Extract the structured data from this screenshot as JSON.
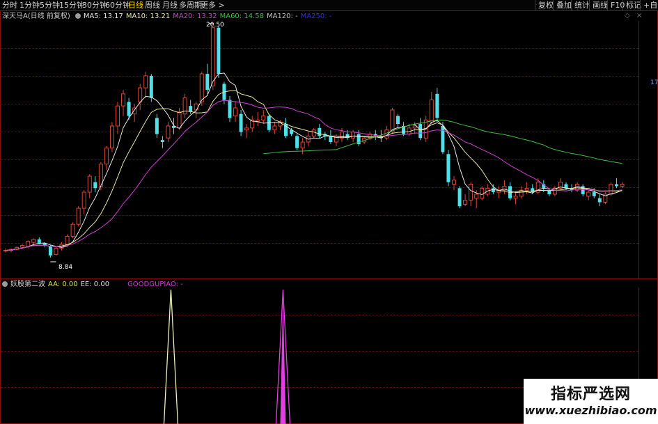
{
  "toolbar": {
    "periods": [
      "分时",
      "1分钟",
      "5分钟",
      "15分钟",
      "30分钟",
      "60分钟",
      "日线",
      "周线",
      "月线",
      "多周期",
      "更多 >"
    ],
    "active_period": "日线",
    "buttons": [
      "复权",
      "叠加",
      "统计",
      "画线",
      "F10",
      "标记",
      "+自选"
    ]
  },
  "main_chart": {
    "stock_name": "深天马A",
    "adjust_mode": "(日线 前复权)",
    "ma": [
      {
        "label": "MA5: 13.17",
        "color": "#e8e8e8"
      },
      {
        "label": "MA10: 13.21",
        "color": "#e8e8a0"
      },
      {
        "label": "MA20: 13.32",
        "color": "#d040d0"
      },
      {
        "label": "MA60: 14.58",
        "color": "#40c040"
      },
      {
        "label": "MA120: -",
        "color": "#c0c0c0"
      },
      {
        "label": "MA250: -",
        "color": "#3030e0"
      }
    ],
    "high_label": "20.50",
    "low_label": "8.84",
    "right_axis_label": "17"
  },
  "indicator": {
    "name": "妖股第二波",
    "values": [
      {
        "label": "AA: 0.00",
        "color": "#e0e060"
      },
      {
        "label": "EE: 0.00",
        "color": "#e0e0e0"
      },
      {
        "label": "GOODGUPIAO: -",
        "color": "#d040d0"
      }
    ],
    "spikes": [
      {
        "bar_index": 29,
        "value": 1.0,
        "color": "#f0f0c0"
      },
      {
        "bar_index": 49,
        "value": 1.0,
        "color": "#e040e0"
      }
    ]
  },
  "colors": {
    "up": "#d84a3a",
    "down": "#50e0e8",
    "frame": "#8a1010"
  },
  "candles": [
    [
      9.2,
      9.3,
      9.1,
      9.2
    ],
    [
      9.2,
      9.3,
      9.1,
      9.25
    ],
    [
      9.25,
      9.4,
      9.2,
      9.35
    ],
    [
      9.35,
      9.5,
      9.3,
      9.45
    ],
    [
      9.4,
      9.7,
      9.3,
      9.65
    ],
    [
      9.6,
      9.8,
      9.4,
      9.75
    ],
    [
      9.75,
      9.85,
      9.5,
      9.55
    ],
    [
      9.55,
      9.6,
      9.35,
      9.45
    ],
    [
      9.4,
      9.45,
      8.84,
      8.95
    ],
    [
      9.0,
      9.4,
      8.95,
      9.3
    ],
    [
      9.3,
      9.6,
      9.2,
      9.5
    ],
    [
      9.5,
      10.0,
      9.4,
      9.9
    ],
    [
      9.9,
      10.6,
      9.8,
      10.5
    ],
    [
      10.5,
      11.4,
      10.4,
      11.3
    ],
    [
      11.3,
      12.2,
      11.0,
      12.1
    ],
    [
      12.1,
      13.0,
      11.8,
      12.9
    ],
    [
      12.6,
      12.9,
      12.1,
      12.3
    ],
    [
      12.4,
      13.6,
      12.2,
      13.5
    ],
    [
      13.5,
      14.4,
      13.2,
      14.3
    ],
    [
      14.3,
      15.6,
      14.1,
      15.4
    ],
    [
      15.4,
      16.6,
      15.0,
      16.4
    ],
    [
      16.4,
      17.2,
      15.9,
      17.0
    ],
    [
      16.6,
      16.8,
      15.7,
      15.9
    ],
    [
      16.0,
      16.5,
      15.6,
      16.3
    ],
    [
      16.6,
      17.5,
      16.2,
      17.3
    ],
    [
      17.3,
      18.1,
      16.8,
      17.9
    ],
    [
      17.9,
      18.0,
      16.6,
      16.8
    ],
    [
      15.8,
      16.0,
      14.8,
      15.0
    ],
    [
      14.7,
      14.9,
      14.3,
      14.6
    ],
    [
      14.8,
      15.6,
      14.6,
      15.4
    ],
    [
      15.4,
      15.8,
      15.0,
      15.3
    ],
    [
      15.3,
      16.3,
      15.2,
      16.1
    ],
    [
      16.0,
      17.0,
      15.8,
      16.8
    ],
    [
      16.4,
      16.7,
      16.0,
      16.1
    ],
    [
      16.2,
      16.6,
      15.8,
      16.5
    ],
    [
      16.6,
      18.1,
      16.4,
      18.0
    ],
    [
      18.0,
      18.5,
      17.0,
      17.2
    ],
    [
      17.4,
      20.5,
      17.2,
      20.3
    ],
    [
      20.3,
      20.4,
      17.8,
      18.0
    ],
    [
      17.5,
      17.6,
      16.5,
      16.7
    ],
    [
      16.7,
      16.9,
      15.6,
      15.8
    ],
    [
      15.9,
      16.6,
      15.6,
      16.3
    ],
    [
      16.0,
      16.2,
      14.9,
      15.1
    ],
    [
      15.2,
      15.5,
      14.8,
      15.3
    ],
    [
      15.3,
      15.9,
      15.1,
      15.7
    ],
    [
      15.6,
      16.1,
      15.4,
      15.7
    ],
    [
      15.7,
      16.2,
      15.5,
      15.9
    ],
    [
      15.9,
      16.0,
      15.1,
      15.2
    ],
    [
      15.2,
      15.6,
      15.0,
      15.4
    ],
    [
      15.4,
      15.7,
      15.2,
      15.6
    ],
    [
      15.5,
      15.8,
      14.8,
      14.9
    ],
    [
      15.2,
      15.3,
      14.9,
      15.0
    ],
    [
      14.9,
      15.0,
      14.2,
      14.3
    ],
    [
      14.3,
      14.8,
      14.0,
      14.6
    ],
    [
      14.6,
      15.1,
      14.4,
      14.9
    ],
    [
      14.9,
      15.3,
      14.8,
      15.2
    ],
    [
      15.3,
      15.5,
      14.8,
      14.9
    ],
    [
      15.0,
      15.1,
      14.7,
      14.9
    ],
    [
      14.9,
      15.2,
      14.5,
      14.6
    ],
    [
      14.6,
      15.0,
      14.4,
      14.9
    ],
    [
      14.8,
      15.3,
      14.6,
      15.1
    ],
    [
      15.0,
      15.2,
      14.7,
      14.8
    ],
    [
      14.8,
      15.2,
      14.6,
      15.1
    ],
    [
      15.0,
      15.2,
      14.4,
      14.5
    ],
    [
      14.6,
      14.9,
      14.5,
      14.8
    ],
    [
      14.8,
      15.1,
      14.7,
      15.0
    ],
    [
      15.0,
      15.2,
      14.7,
      14.9
    ],
    [
      14.9,
      15.2,
      14.6,
      14.8
    ],
    [
      14.8,
      15.4,
      14.7,
      15.2
    ],
    [
      15.1,
      16.3,
      15.0,
      16.2
    ],
    [
      15.9,
      16.0,
      15.3,
      15.5
    ],
    [
      15.4,
      15.6,
      14.9,
      15.0
    ],
    [
      15.0,
      15.5,
      14.9,
      15.3
    ],
    [
      15.3,
      15.6,
      15.0,
      15.4
    ],
    [
      15.5,
      15.8,
      14.7,
      14.8
    ],
    [
      14.8,
      15.9,
      14.6,
      15.7
    ],
    [
      15.6,
      17.1,
      15.5,
      16.7
    ],
    [
      17.0,
      17.3,
      15.6,
      15.8
    ],
    [
      15.4,
      15.6,
      14.0,
      14.1
    ],
    [
      14.0,
      14.2,
      12.4,
      12.6
    ],
    [
      12.5,
      12.9,
      12.2,
      12.7
    ],
    [
      12.3,
      12.4,
      11.3,
      11.4
    ],
    [
      11.5,
      12.0,
      11.4,
      11.7
    ],
    [
      11.7,
      12.6,
      11.4,
      12.5
    ],
    [
      11.8,
      12.2,
      11.3,
      12.0
    ],
    [
      11.8,
      12.4,
      11.7,
      12.3
    ],
    [
      12.0,
      12.5,
      11.9,
      12.3
    ],
    [
      12.3,
      12.5,
      12.0,
      12.1
    ],
    [
      12.1,
      12.4,
      11.8,
      12.2
    ],
    [
      12.2,
      12.7,
      12.0,
      12.4
    ],
    [
      12.4,
      12.6,
      11.7,
      11.8
    ],
    [
      11.8,
      12.1,
      11.5,
      11.9
    ],
    [
      11.9,
      12.4,
      11.8,
      12.2
    ],
    [
      12.2,
      12.6,
      12.0,
      12.3
    ],
    [
      12.3,
      12.5,
      12.0,
      12.1
    ],
    [
      12.1,
      12.8,
      12.0,
      12.6
    ],
    [
      12.5,
      12.7,
      12.1,
      12.3
    ],
    [
      12.2,
      12.3,
      11.9,
      12.0
    ],
    [
      12.0,
      12.4,
      11.9,
      12.3
    ],
    [
      12.3,
      12.8,
      12.2,
      12.6
    ],
    [
      12.5,
      12.6,
      12.2,
      12.3
    ],
    [
      12.3,
      12.5,
      12.1,
      12.2
    ],
    [
      12.2,
      12.6,
      12.1,
      12.5
    ],
    [
      12.4,
      12.5,
      11.9,
      12.0
    ],
    [
      11.9,
      12.2,
      11.7,
      12.1
    ],
    [
      12.1,
      12.3,
      11.8,
      11.9
    ],
    [
      11.8,
      12.0,
      11.4,
      11.6
    ],
    [
      11.6,
      12.1,
      11.5,
      12.0
    ],
    [
      12.0,
      12.6,
      11.9,
      12.5
    ],
    [
      12.5,
      12.8,
      12.3,
      12.4
    ],
    [
      12.4,
      12.6,
      12.3,
      12.5
    ]
  ]
}
